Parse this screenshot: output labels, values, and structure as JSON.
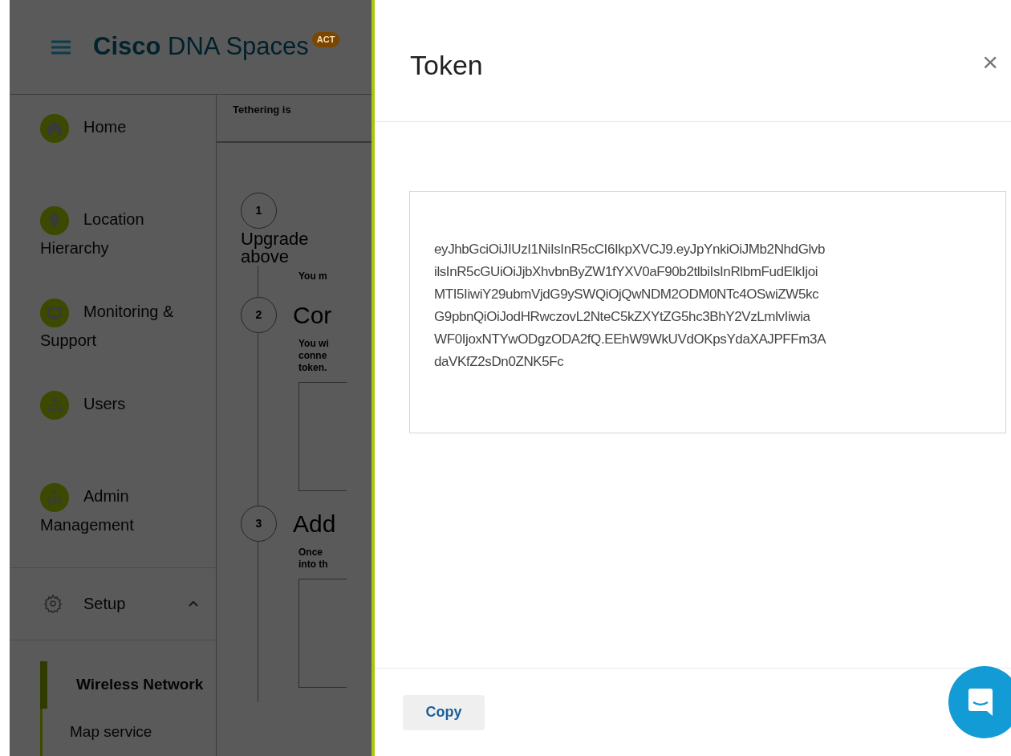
{
  "app_header": {
    "brand_bold": "Cisco",
    "brand_rest": "DNA Spaces",
    "badge": "ACT"
  },
  "sidebar": {
    "items": [
      {
        "label": "Home",
        "kind": "home"
      },
      {
        "label": "Location Hierarchy",
        "kind": "pin"
      },
      {
        "label": "Monitoring & Support",
        "kind": "monitor"
      },
      {
        "label": "Users",
        "kind": "org"
      },
      {
        "label": "Admin Management",
        "kind": "org"
      }
    ],
    "setup": {
      "label": "Setup",
      "expanded": true,
      "children": [
        {
          "label": "Wireless Network",
          "selected": true
        },
        {
          "label": "Map service",
          "selected": false
        }
      ]
    }
  },
  "background_content": {
    "banner": "Tethering is",
    "steps": [
      {
        "number": "1",
        "title": "Upgrade above",
        "lines": [
          "You m"
        ],
        "boxed": false
      },
      {
        "number": "2",
        "title": "Cor",
        "lines": [
          "You wi",
          "conne",
          "token."
        ],
        "boxed": true
      },
      {
        "number": "3",
        "title": "Add",
        "lines": [
          "Once",
          "into th"
        ],
        "boxed": true
      }
    ]
  },
  "drawer": {
    "title": "Token",
    "close": "×",
    "token_lines": [
      "eyJhbGciOiJIUzI1NiIsInR5cCI6IkpXVCJ9.eyJpYnkiOiJMb2NhdGlvb",
      "ilsInR5cGUiOiJjbXhvbnByZW1fYXV0aF90b2tlbiIsInRlbmFudElkIjoi",
      "MTI5IiwiY29ubmVjdG9ySWQiOjQwNDM2ODM0NTc4OSwiZW5kc",
      "G9pbnQiOiJodHRwczovL2NteC5kZXYtZG5hc3BhY2VzLmlvIiwia",
      "WF0IjoxNTYwODgzODA2fQ.EEhW9WkUVdOKpsYdaXAJPFFm3A",
      "daVKfZ2sDn0ZNK5Fc"
    ],
    "copy": "Copy"
  }
}
